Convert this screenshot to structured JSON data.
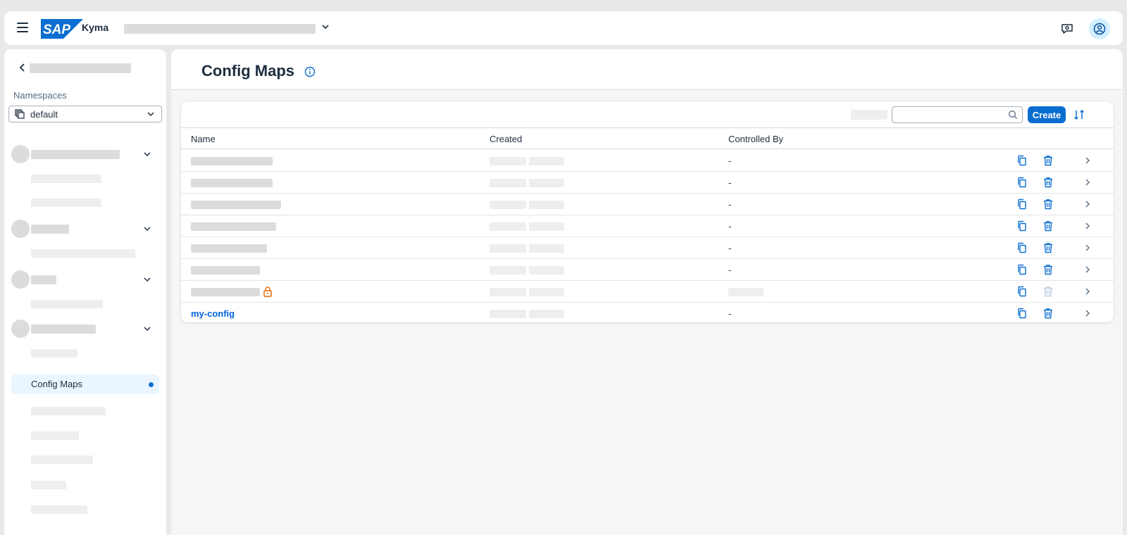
{
  "shell": {
    "product": "Kyma",
    "logo_text": "SAP"
  },
  "sidebar": {
    "namespaces_label": "Namespaces",
    "namespace_value": "default",
    "active_item": "Config Maps"
  },
  "page": {
    "title": "Config Maps"
  },
  "toolbar": {
    "search_placeholder": "",
    "create_label": "Create"
  },
  "table": {
    "columns": [
      "Name",
      "Created",
      "Controlled By"
    ],
    "rows": [
      {
        "controlled_by": "-"
      },
      {
        "controlled_by": "-"
      },
      {
        "controlled_by": "-"
      },
      {
        "controlled_by": "-"
      },
      {
        "controlled_by": "-"
      },
      {
        "controlled_by": "-"
      },
      {
        "controlled_by": ""
      },
      {
        "name": "my-config",
        "controlled_by": "-"
      }
    ]
  },
  "colors": {
    "accent": "#0a6ed1",
    "link": "#0064d9",
    "warning": "#e76500"
  }
}
